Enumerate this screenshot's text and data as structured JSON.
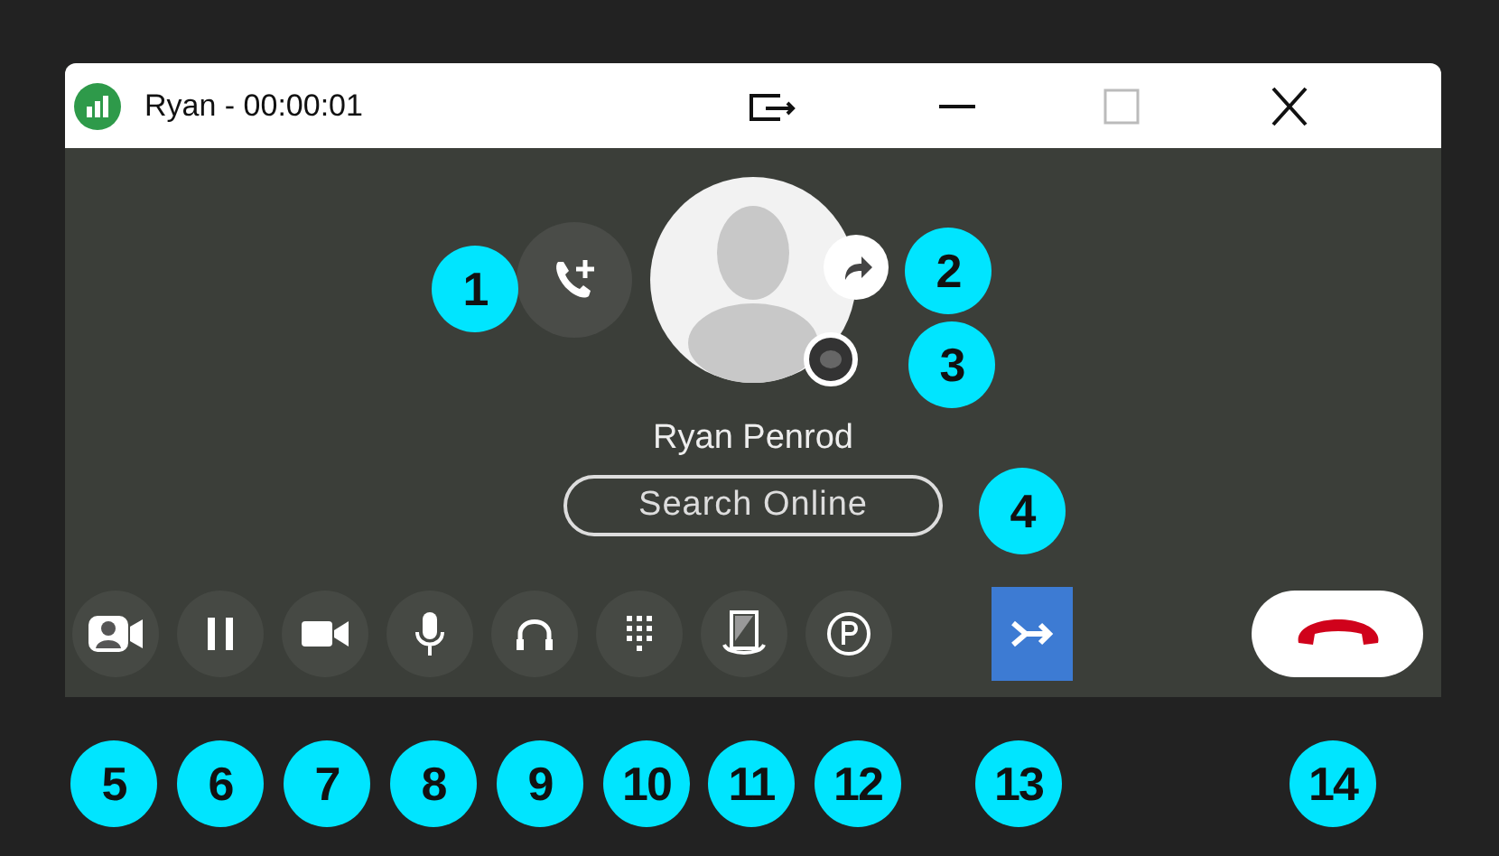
{
  "window": {
    "title": "Ryan - 00:00:01"
  },
  "contact": {
    "name": "Ryan Penrod",
    "search_button": "Search Online"
  },
  "toolbar": [
    {
      "kind": "contact-card",
      "active": false
    },
    {
      "kind": "pause",
      "active": false
    },
    {
      "kind": "video",
      "active": false
    },
    {
      "kind": "microphone",
      "active": false
    },
    {
      "kind": "headset",
      "active": false
    },
    {
      "kind": "keypad",
      "active": false
    },
    {
      "kind": "transfer-device",
      "active": false
    },
    {
      "kind": "park",
      "active": false
    },
    {
      "kind": "merge",
      "active": true
    }
  ],
  "hangup": {
    "kind": "end-call"
  },
  "callouts": [
    {
      "label": "1"
    },
    {
      "label": "2"
    },
    {
      "label": "3"
    },
    {
      "label": "4"
    },
    {
      "label": "5"
    },
    {
      "label": "6"
    },
    {
      "label": "7"
    },
    {
      "label": "8"
    },
    {
      "label": "9"
    },
    {
      "label": "10"
    },
    {
      "label": "11"
    },
    {
      "label": "12"
    },
    {
      "label": "13"
    },
    {
      "label": "14"
    }
  ]
}
